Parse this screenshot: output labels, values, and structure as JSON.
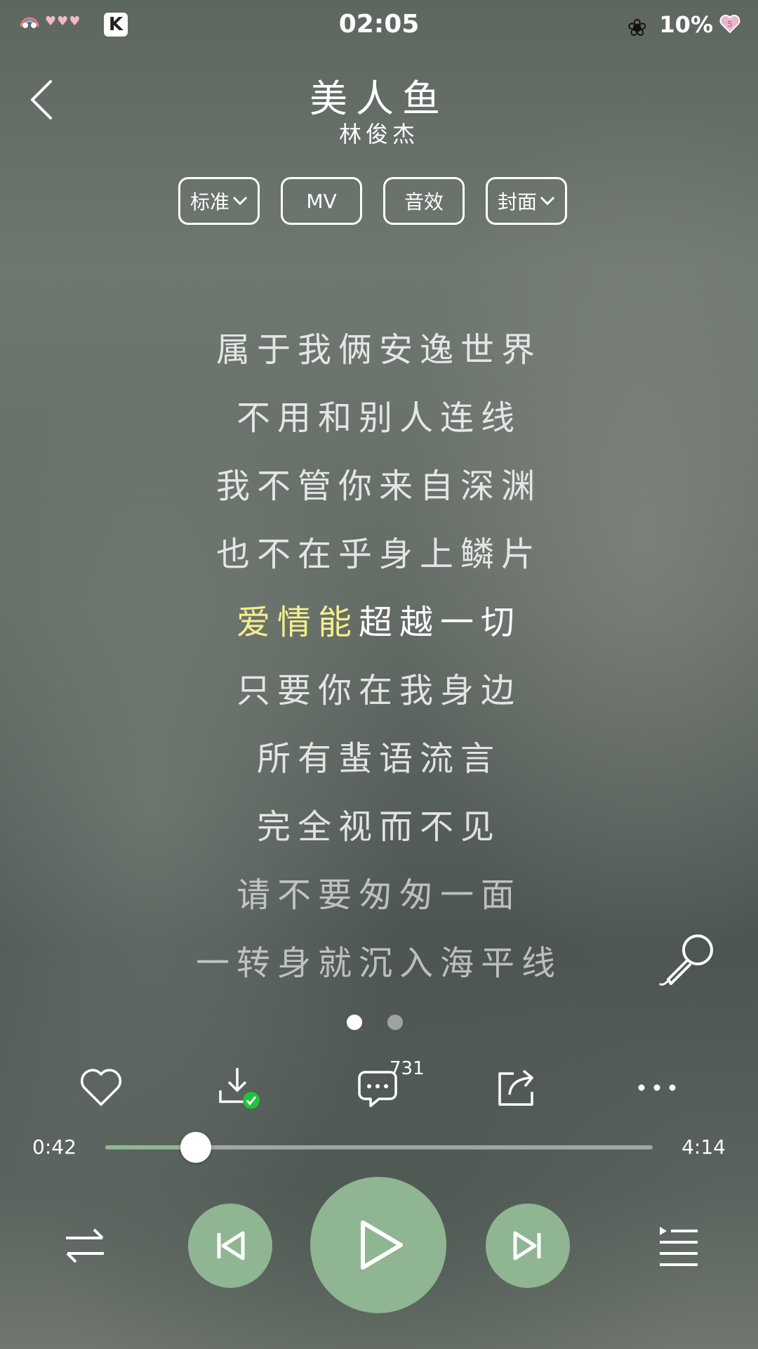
{
  "status": {
    "time": "02:05",
    "battery": "10%",
    "app_badge": "K",
    "icons": [
      "rainbow-icon",
      "hearts-icon",
      "kugou-icon",
      "flower-icon",
      "heart-battery-icon"
    ]
  },
  "header": {
    "title": "美人鱼",
    "artist": "林俊杰"
  },
  "chips": [
    {
      "label": "标准",
      "dropdown": true
    },
    {
      "label": "MV",
      "dropdown": false
    },
    {
      "label": "音效",
      "dropdown": false
    },
    {
      "label": "封面",
      "dropdown": true
    }
  ],
  "lyrics": {
    "lines": [
      "属于我俩安逸世界",
      "不用和别人连线",
      "我不管你来自深渊",
      "也不在乎身上鳞片",
      "爱情能超越一切",
      "只要你在我身边",
      "所有蜚语流言",
      "完全视而不见",
      "请不要匆匆一面",
      "一转身就沉入海平线"
    ],
    "active_index": 4,
    "active_highlight": "爱情能",
    "active_rest": "超越一切"
  },
  "pager": {
    "count": 2,
    "current": 0
  },
  "actions": {
    "comment_count": "731",
    "icons": [
      "heart-icon",
      "download-done-icon",
      "comment-icon",
      "share-icon",
      "more-icon"
    ]
  },
  "progress": {
    "current": "0:42",
    "total": "4:14",
    "fraction": 0.1654
  },
  "controls": {
    "icons": [
      "shuffle-icon",
      "previous-icon",
      "play-icon",
      "next-icon",
      "playlist-icon"
    ]
  },
  "colors": {
    "accent": "#8fb593",
    "highlight": "#f4ef8c",
    "download_check": "#1ec43a"
  }
}
